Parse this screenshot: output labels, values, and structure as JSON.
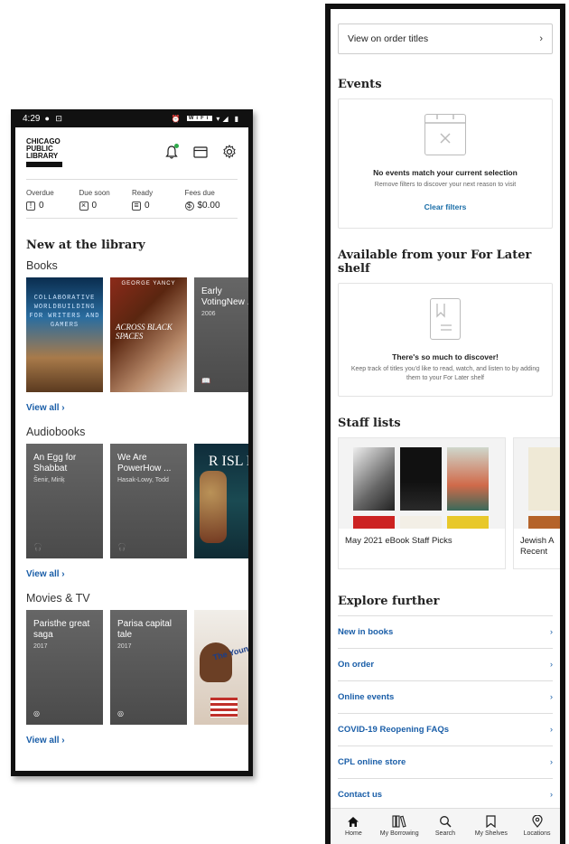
{
  "left": {
    "status": {
      "time": "4:29",
      "icons_left": "● ⊡",
      "badge": "WiFi"
    },
    "logo": [
      "CHICAGO",
      "PUBLIC",
      "LIBRARY"
    ],
    "stats": [
      {
        "label": "Overdue",
        "value": "0",
        "icon": "!"
      },
      {
        "label": "Due soon",
        "value": "0",
        "icon": "×"
      },
      {
        "label": "Ready",
        "value": "0",
        "icon": "≡"
      },
      {
        "label": "Fees due",
        "value": "$0.00",
        "icon": "$"
      }
    ],
    "new_heading": "New at the library",
    "books": {
      "title": "Books",
      "items": [
        {
          "title": "COLLABORATIVE WORLDBUILDING FOR WRITERS AND GAMERS"
        },
        {
          "author": "GEORGE YANCY",
          "title": "ACROSS BLACK SPACES"
        },
        {
          "title": "Early VotingNew ...",
          "sub": "2006"
        }
      ],
      "view_all": "View all ›"
    },
    "audiobooks": {
      "title": "Audiobooks",
      "items": [
        {
          "title": "An Egg for Shabbat",
          "sub": "Šenir, Miriķ"
        },
        {
          "title": "We Are PowerHow ...",
          "sub": "Hasak-Lowy, Todd"
        },
        {
          "title": "R ISL HO",
          "author": "ANDR"
        }
      ],
      "view_all": "View all ›"
    },
    "movies": {
      "title": "Movies & TV",
      "items": [
        {
          "title": "Paristhe great saga",
          "sub": "2017"
        },
        {
          "title": "Parisa capital tale",
          "sub": "2017"
        },
        {
          "title": "The Young Ma"
        }
      ],
      "view_all": "View all ›"
    }
  },
  "right": {
    "order_button": "View on order titles",
    "events": {
      "heading": "Events",
      "empty_title": "No events match your current selection",
      "empty_sub": "Remove filters to discover your next reason to visit",
      "link": "Clear filters"
    },
    "for_later": {
      "heading": "Available from your For Later shelf",
      "empty_title": "There's so much to discover!",
      "empty_sub": "Keep track of titles you'd like to read, watch, and listen to by adding them to your For Later shelf"
    },
    "staff": {
      "heading": "Staff lists",
      "cards": [
        {
          "title": "May 2021 eBook Staff Picks"
        },
        {
          "title": "Jewish A Recent"
        }
      ]
    },
    "explore": {
      "heading": "Explore further",
      "items": [
        "New in books",
        "On order",
        "Online events",
        "COVID-19 Reopening FAQs",
        "CPL online store",
        "Contact us"
      ]
    },
    "tabs": [
      "Home",
      "My Borrowing",
      "Search",
      "My Shelves",
      "Locations"
    ]
  }
}
